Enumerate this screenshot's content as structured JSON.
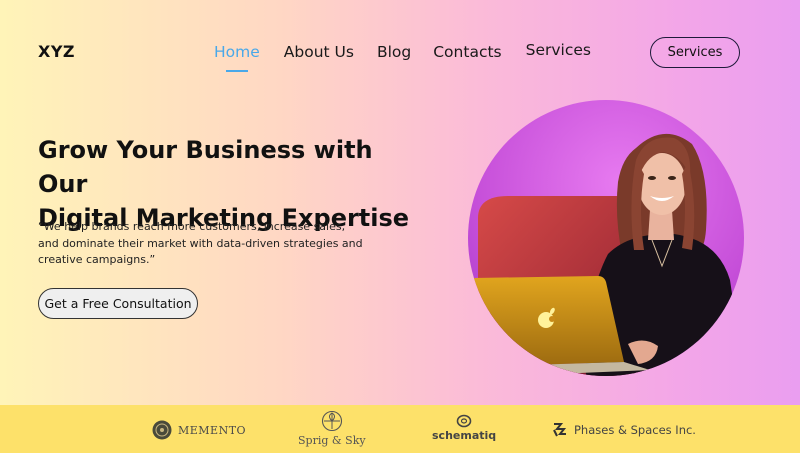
{
  "header": {
    "logo": "XYZ",
    "nav": [
      {
        "label": "Home",
        "active": true
      },
      {
        "label": "About Us",
        "active": false
      },
      {
        "label": "Blog",
        "active": false
      },
      {
        "label": "Contacts",
        "active": false
      },
      {
        "label": "Services",
        "active": false
      }
    ],
    "cta_label": "Services"
  },
  "hero": {
    "headline_line1": "Grow Your Business with Our",
    "headline_line2": "Digital Marketing Expertise",
    "quote_line1": "“We help brands reach more customers, increase sales,",
    "quote_line2": "and dominate their market with data-driven strategies and",
    "quote_line3": "creative campaigns.”",
    "cta_label": "Get a Free Consultation",
    "image_icon": "woman-with-laptop-photo"
  },
  "brands": [
    {
      "name": "MEMENTO",
      "icon": "memento-logo-icon"
    },
    {
      "name": "Sprig & Sky",
      "icon": "sprig-sky-logo-icon"
    },
    {
      "name": "schematiq",
      "icon": "schematiq-logo-icon"
    },
    {
      "name": "Phases & Spaces Inc.",
      "icon": "phases-spaces-logo-icon"
    }
  ],
  "colors": {
    "accent": "#49a8e9",
    "brand_bar": "#fde16a",
    "bg_left": "#fff4b8",
    "bg_right": "#ea9ef0",
    "photo_bg": "#d25ee0"
  }
}
